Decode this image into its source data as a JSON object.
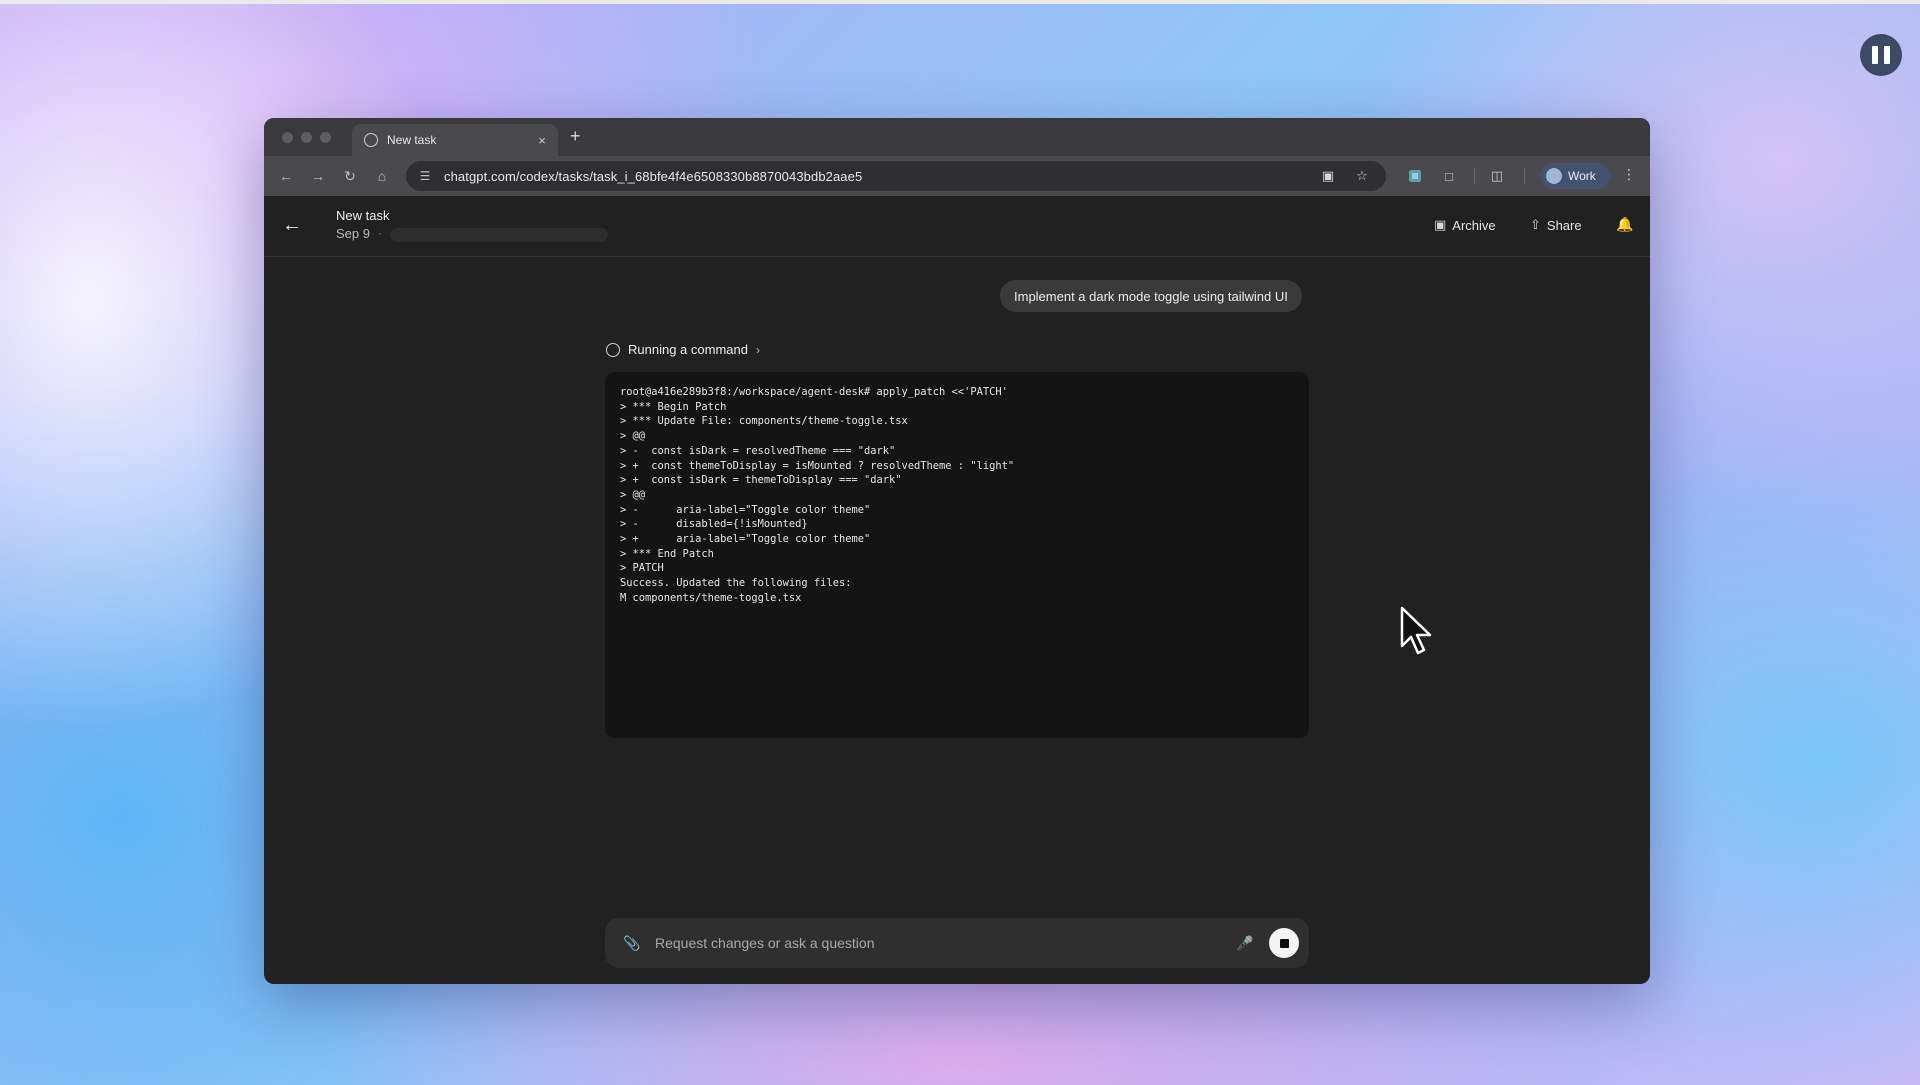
{
  "browser": {
    "tab_title": "New task",
    "tab_close": "×",
    "new_tab": "+",
    "url": "chatgpt.com/codex/tasks/task_i_68bfe4f4e6508330b8870043bdb2aae5",
    "profile_label": "Work",
    "icons": {
      "back": "arrow-left-icon",
      "forward": "arrow-right-icon",
      "reload": "reload-icon",
      "home": "home-icon",
      "site_info": "tune-icon",
      "install": "install-icon",
      "bookmark": "star-icon",
      "extension": "puzzle-icon",
      "split": "split-view-icon",
      "menu": "kebab-icon"
    }
  },
  "header": {
    "title": "New task",
    "date": "Sep 9",
    "archive_label": "Archive",
    "share_label": "Share"
  },
  "conversation": {
    "user_message": "Implement a dark mode toggle using tailwind UI",
    "status_label": "Running a command",
    "terminal_lines": [
      "root@a416e289b3f8:/workspace/agent-desk# apply_patch <<'PATCH'",
      "> *** Begin Patch",
      "> *** Update File: components/theme-toggle.tsx",
      "> @@",
      "> -  const isDark = resolvedTheme === \"dark\"",
      "> +  const themeToDisplay = isMounted ? resolvedTheme : \"light\"",
      "> +  const isDark = themeToDisplay === \"dark\"",
      "> @@",
      "> -      aria-label=\"Toggle color theme\"",
      "> -      disabled={!isMounted}",
      "> +      aria-label=\"Toggle color theme\"",
      "> *** End Patch",
      "> PATCH",
      "Success. Updated the following files:",
      "M components/theme-toggle.tsx"
    ]
  },
  "composer": {
    "placeholder": "Request changes or ask a question"
  },
  "colors": {
    "app_bg": "#212121",
    "terminal_bg": "#141414",
    "profile_chip": "#43536f",
    "pause_button": "#3c4a66"
  }
}
